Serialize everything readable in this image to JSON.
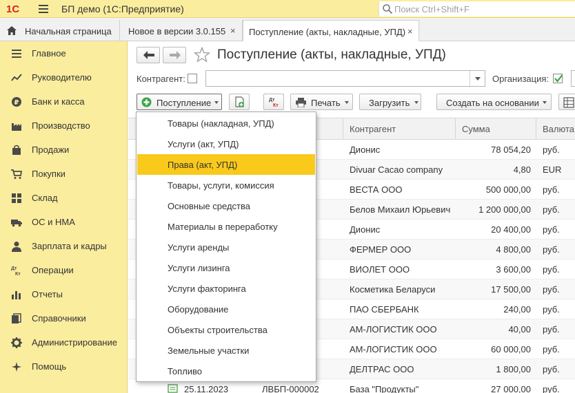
{
  "app": {
    "title": "БП демо  (1С:Предприятие)",
    "search_placeholder": "Поиск Ctrl+Shift+F",
    "logo_text": "1С"
  },
  "tabs": [
    {
      "label": "Начальная страница"
    },
    {
      "label": "Новое в версии 3.0.155",
      "close": "×"
    },
    {
      "label": "Поступление (акты, накладные, УПД)",
      "close": "×"
    }
  ],
  "sidebar": {
    "items": [
      {
        "label": "Главное",
        "icon": "menu-lines-icon"
      },
      {
        "label": "Руководителю",
        "icon": "chart-trend-icon"
      },
      {
        "label": "Банк и касса",
        "icon": "ruble-coin-icon"
      },
      {
        "label": "Производство",
        "icon": "factory-icon"
      },
      {
        "label": "Продажи",
        "icon": "shopping-bag-icon"
      },
      {
        "label": "Покупки",
        "icon": "cart-icon"
      },
      {
        "label": "Склад",
        "icon": "warehouse-grid-icon"
      },
      {
        "label": "ОС и НМА",
        "icon": "truck-icon"
      },
      {
        "label": "Зарплата и кадры",
        "icon": "person-icon"
      },
      {
        "label": "Операции",
        "icon": "dt-kt-icon",
        "icon_text": "Дт Кт"
      },
      {
        "label": "Отчеты",
        "icon": "bar-chart-icon"
      },
      {
        "label": "Справочники",
        "icon": "books-icon"
      },
      {
        "label": "Администрирование",
        "icon": "gear-icon"
      },
      {
        "label": "Помощь",
        "icon": "help-icon"
      }
    ]
  },
  "main": {
    "title": "Поступление (акты, накладные, УПД)",
    "filters": {
      "counterparty_label": "Контрагент:",
      "organization_label": "Организация:"
    },
    "toolbar": {
      "receipt_label": "Поступление",
      "dtkt_text": "Дт Кт",
      "print_label": "Печать",
      "load_label": "Загрузить",
      "create_based_label": "Создать на основании"
    },
    "table": {
      "columns": [
        "Контрагент",
        "Сумма",
        "Валюта"
      ],
      "rows": [
        {
          "counterparty": "Дионис",
          "sum": "78 054,20",
          "currency": "руб."
        },
        {
          "counterparty": "Divuar Cacao company",
          "sum": "4,80",
          "currency": "EUR"
        },
        {
          "counterparty": "ВЕСТА ООО",
          "sum": "500 000,00",
          "currency": "руб."
        },
        {
          "counterparty": "Белов Михаил Юрьевич",
          "sum": "1 200 000,00",
          "currency": "руб."
        },
        {
          "counterparty": "Дионис",
          "sum": "20 400,00",
          "currency": "руб."
        },
        {
          "counterparty": "ФЕРМЕР ООО",
          "sum": "4 800,00",
          "currency": "руб."
        },
        {
          "counterparty": "ВИОЛЕТ ООО",
          "sum": "3 600,00",
          "currency": "руб."
        },
        {
          "counterparty": "Косметика Беларуси",
          "sum": "17 500,00",
          "currency": "руб."
        },
        {
          "counterparty": "ПАО СБЕРБАНК",
          "sum": "240,00",
          "currency": "руб."
        },
        {
          "counterparty": "АМ-ЛОГИСТИК ООО",
          "sum": "40,00",
          "currency": "руб."
        },
        {
          "counterparty": "АМ-ЛОГИСТИК ООО",
          "sum": "60 000,00",
          "currency": "руб."
        },
        {
          "counterparty": "ДЕЛТРАС ООО",
          "sum": "1 800,00",
          "currency": "руб."
        },
        {
          "date": "25.11.2023",
          "number": "ЛВБП-000002",
          "counterparty": "База \"Продукты\"",
          "sum": "27 000,00",
          "currency": "руб."
        }
      ]
    }
  },
  "dropdown": {
    "items": [
      {
        "label": "Товары (накладная, УПД)"
      },
      {
        "label": "Услуги (акт, УПД)"
      },
      {
        "label": "Права (акт, УПД)",
        "highlighted": true
      },
      {
        "label": "Товары, услуги, комиссия"
      },
      {
        "label": "Основные средства"
      },
      {
        "label": "Материалы в переработку"
      },
      {
        "label": "Услуги аренды"
      },
      {
        "label": "Услуги лизинга"
      },
      {
        "label": "Услуги факторинга"
      },
      {
        "label": "Оборудование"
      },
      {
        "label": "Объекты строительства"
      },
      {
        "label": "Земельные участки"
      },
      {
        "label": "Топливо"
      }
    ]
  },
  "colors": {
    "panel_yellow": "#fbed9e",
    "highlight": "#f9c91c",
    "logo_red": "#d6241c",
    "accent_green": "#3aa64a"
  }
}
